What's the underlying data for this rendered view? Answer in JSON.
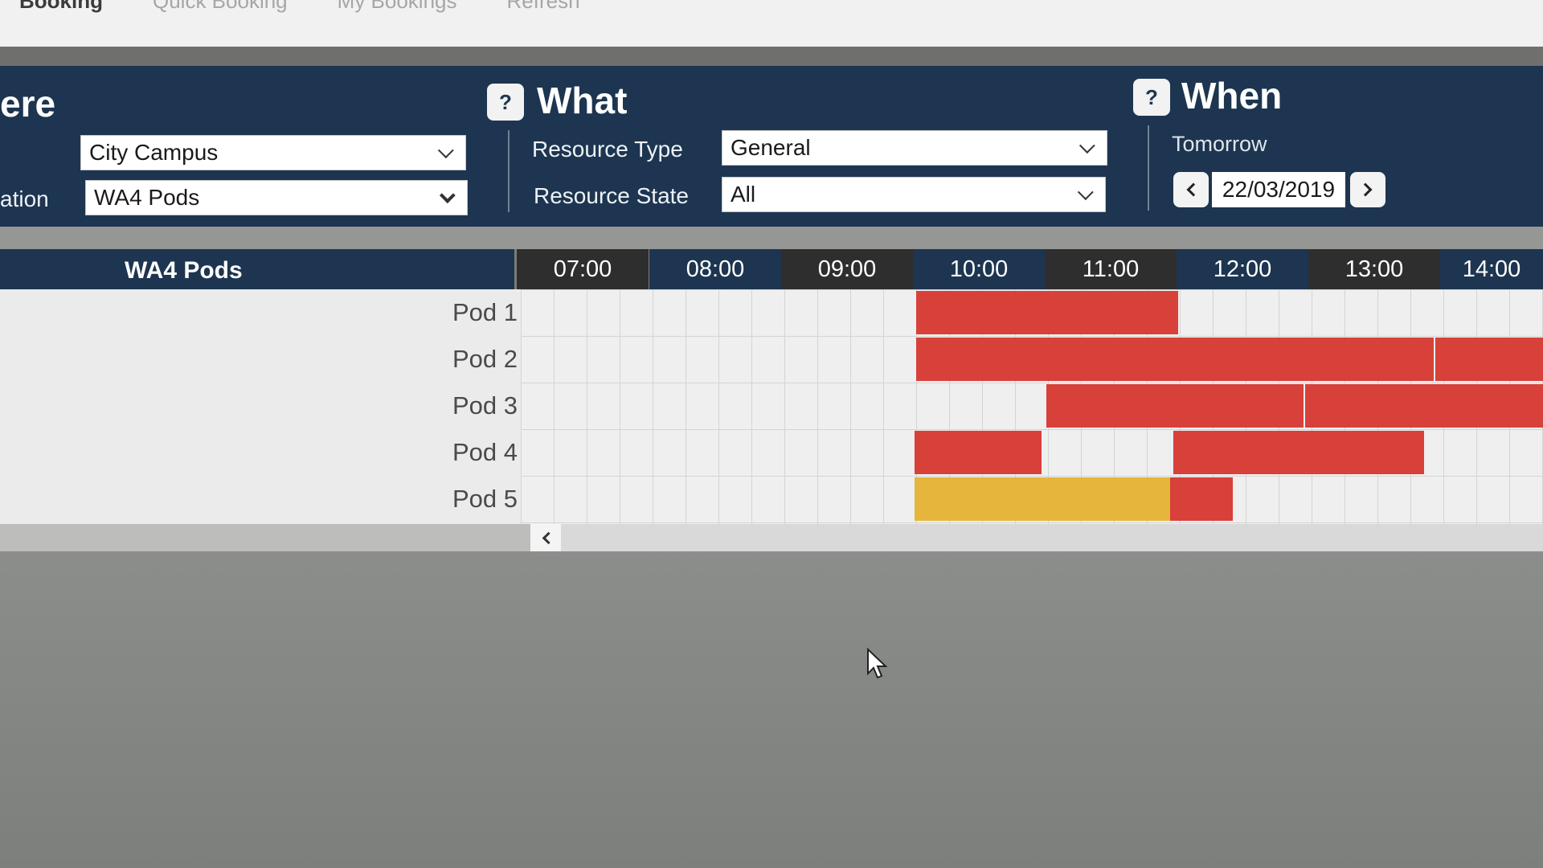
{
  "nav": {
    "tabs": [
      {
        "label": "Booking"
      },
      {
        "label": "Quick Booking"
      },
      {
        "label": "My Bookings"
      },
      {
        "label": "Refresh"
      }
    ]
  },
  "where": {
    "title": "ere",
    "campus_value": "City Campus",
    "location_label": "ation",
    "location_value": "WA4 Pods"
  },
  "what": {
    "help": "?",
    "title": "What",
    "resource_type_label": "Resource Type",
    "resource_type_value": "General",
    "resource_state_label": "Resource State",
    "resource_state_value": "All"
  },
  "when": {
    "help": "?",
    "title": "When",
    "subtitle": "Tomorrow",
    "date": "22/03/2019"
  },
  "grid": {
    "title": "WA4 Pods",
    "hours": [
      "07:00",
      "08:00",
      "09:00",
      "10:00",
      "11:00",
      "12:00",
      "13:00",
      "14:00"
    ],
    "rows": [
      {
        "label": "Pod 1"
      },
      {
        "label": "Pod 2"
      },
      {
        "label": "Pod 3"
      },
      {
        "label": "Pod 4"
      },
      {
        "label": "Pod 5"
      }
    ]
  },
  "colors": {
    "header_navy": "#1d3550",
    "booked_red": "#d8403a",
    "pending_yellow": "#e6b53b"
  }
}
